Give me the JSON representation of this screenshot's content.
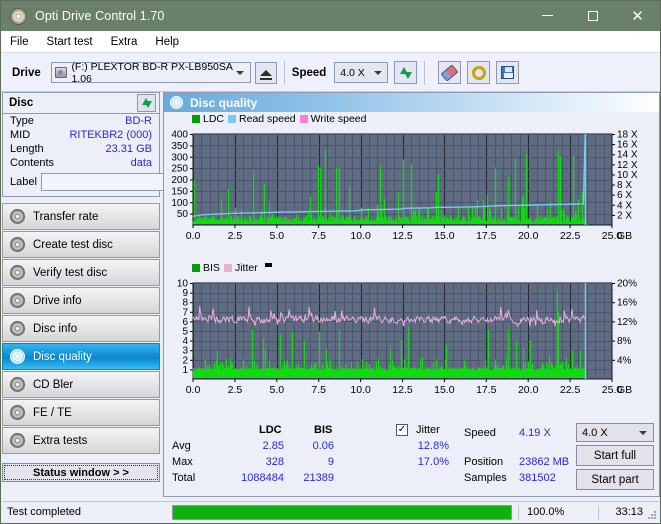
{
  "window": {
    "title": "Opti Drive Control 1.70",
    "icon": "disc-icon",
    "minimize": "minimize-icon",
    "maximize": "maximize-icon",
    "close": "✕"
  },
  "menu": [
    {
      "label": "File"
    },
    {
      "label": "Start test"
    },
    {
      "label": "Extra"
    },
    {
      "label": "Help"
    }
  ],
  "toolbar": {
    "drive_label": "Drive",
    "drive_value": "(F:)  PLEXTOR BD-R  PX-LB950SA 1.06",
    "eject_icon": "eject-icon",
    "speed_label": "Speed",
    "speed_value": "4.0 X",
    "refresh_icon": "refresh-icon",
    "eraser_icon": "eraser-icon",
    "tools_icon": "wrench-icon",
    "save_icon": "save-icon"
  },
  "disc_panel": {
    "title": "Disc",
    "refresh_icon": "refresh-icon",
    "rows": [
      {
        "key": "Type",
        "value": "BD-R"
      },
      {
        "key": "MID",
        "value": "RITEKBR2 (000)"
      },
      {
        "key": "Length",
        "value": "23.31 GB"
      },
      {
        "key": "Contents",
        "value": "data"
      }
    ],
    "label_key": "Label",
    "label_value": "",
    "label_placeholder": "",
    "label_disc_icon": "disc-icon"
  },
  "sidebar": {
    "items": [
      {
        "label": "Transfer rate",
        "selected": false
      },
      {
        "label": "Create test disc",
        "selected": false
      },
      {
        "label": "Verify test disc",
        "selected": false
      },
      {
        "label": "Drive info",
        "selected": false
      },
      {
        "label": "Disc info",
        "selected": false
      },
      {
        "label": "Disc quality",
        "selected": true
      },
      {
        "label": "CD Bler",
        "selected": false
      },
      {
        "label": "FE / TE",
        "selected": false
      },
      {
        "label": "Extra tests",
        "selected": false
      }
    ],
    "status_window_label": "Status window > >"
  },
  "panel_header": {
    "title": "Disc quality",
    "icon": "disc-quality-icon"
  },
  "chart_data": [
    {
      "id": "top-chart",
      "type": "line",
      "title": "",
      "xlabel": "GB",
      "ylabel": "",
      "xlim": [
        0.0,
        25.0
      ],
      "xticks": [
        "0.0",
        "2.5",
        "5.0",
        "7.5",
        "10.0",
        "12.5",
        "15.0",
        "17.5",
        "20.0",
        "22.5",
        "25.0"
      ],
      "xunit": "GB",
      "ylim": [
        0,
        400
      ],
      "yticks": [
        "50",
        "100",
        "150",
        "200",
        "250",
        "300",
        "350",
        "400"
      ],
      "y2lim": [
        0,
        18
      ],
      "y2ticks": [
        "2 X",
        "4 X",
        "6 X",
        "8 X",
        "10 X",
        "12 X",
        "14 X",
        "16 X",
        "18 X"
      ],
      "grid": true,
      "legend_position": "top-left",
      "legend": [
        {
          "name": "LDC",
          "color": "#00a000"
        },
        {
          "name": "Read speed",
          "color": "#7ec8f0"
        },
        {
          "name": "Write speed",
          "color": "#f57fd0"
        }
      ],
      "series": [
        {
          "name": "Read speed",
          "color": "#7ec8f0",
          "axis": "right",
          "x": [
            0.0,
            0.4,
            1.0,
            1.6,
            2.3,
            3.0,
            3.8,
            4.6,
            5.4,
            6.2,
            7.0,
            7.9,
            8.8,
            9.7,
            10.2,
            10.9,
            11.7,
            12.4,
            12.6,
            13.4,
            14.2,
            14.6,
            15.3,
            16.1,
            16.9,
            17.6,
            18.0,
            18.8,
            19.5,
            20.3,
            20.9,
            21.5,
            22.2,
            22.8,
            23.3,
            23.4
          ],
          "values": [
            1.7,
            2.0,
            2.1,
            2.2,
            2.3,
            2.35,
            2.4,
            2.5,
            2.55,
            2.6,
            2.65,
            2.7,
            2.75,
            2.8,
            3.0,
            3.05,
            3.1,
            3.15,
            3.3,
            3.35,
            3.4,
            3.5,
            3.5,
            3.55,
            3.6,
            3.7,
            3.8,
            3.85,
            3.9,
            3.95,
            4.0,
            4.05,
            4.1,
            4.15,
            4.2,
            18.0
          ]
        },
        {
          "name": "LDC",
          "color": "#00d000",
          "axis": "left",
          "note": "dense green spike bars across 0-23.4 GB, baseline approx 20-40, peaks up to 328"
        }
      ]
    },
    {
      "id": "bottom-chart",
      "type": "line",
      "title": "",
      "xlabel": "GB",
      "ylabel": "",
      "xlim": [
        0.0,
        25.0
      ],
      "xticks": [
        "0.0",
        "2.5",
        "5.0",
        "7.5",
        "10.0",
        "12.5",
        "15.0",
        "17.5",
        "20.0",
        "22.5",
        "25.0"
      ],
      "xunit": "GB",
      "ylim": [
        0,
        10
      ],
      "yticks": [
        "1",
        "2",
        "3",
        "4",
        "5",
        "6",
        "7",
        "8",
        "9",
        "10"
      ],
      "y2lim": [
        0,
        20
      ],
      "y2ticks": [
        "4%",
        "8%",
        "12%",
        "16%",
        "20%"
      ],
      "grid": true,
      "legend_position": "top-left",
      "legend": [
        {
          "name": "BIS",
          "color": "#00a000"
        },
        {
          "name": "Jitter",
          "color": "#e8b0d8"
        }
      ],
      "series": [
        {
          "name": "Jitter",
          "color": "#e8b0d8",
          "axis": "right",
          "note": "noisy band oscillating around 12.5%, range approx 11%-17%"
        },
        {
          "name": "BIS",
          "color": "#00d000",
          "axis": "left",
          "note": "dense green bars baseline 1, frequent spikes to 2-5, max 9"
        }
      ]
    }
  ],
  "stats": {
    "col_headers": [
      "LDC",
      "BIS"
    ],
    "jitter_label": "Jitter",
    "jitter_checked": true,
    "rows": [
      {
        "name": "Avg",
        "ldc": "2.85",
        "bis": "0.06",
        "jitter": "12.8%"
      },
      {
        "name": "Max",
        "ldc": "328",
        "bis": "9",
        "jitter": "17.0%"
      },
      {
        "name": "Total",
        "ldc": "1088484",
        "bis": "21389",
        "jitter": ""
      }
    ],
    "speed_key": "Speed",
    "speed_value": "4.19 X",
    "position_key": "Position",
    "position_value": "23862 MB",
    "samples_key": "Samples",
    "samples_value": "381502",
    "speed_select_value": "4.0 X",
    "start_full_label": "Start full",
    "start_part_label": "Start part"
  },
  "statusbar": {
    "text": "Test completed",
    "progress_pct": "100.0%",
    "progress_value": 100,
    "elapsed": "33:13"
  }
}
